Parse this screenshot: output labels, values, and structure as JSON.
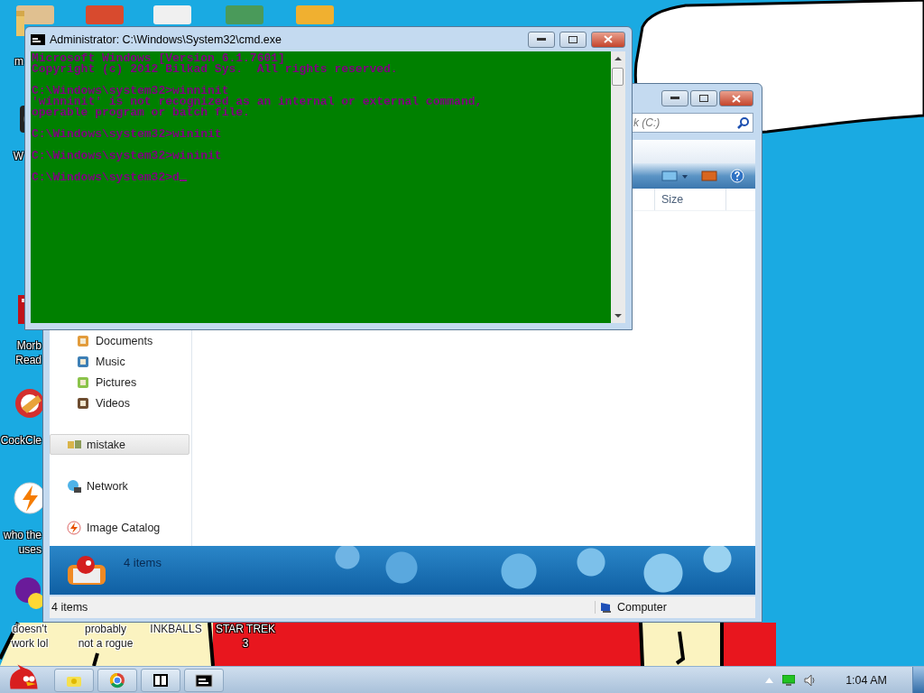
{
  "desktop_icons": [
    {
      "label": "m",
      "kind": "folder"
    },
    {
      "label": "W",
      "kind": "app"
    },
    {
      "label": "Morb\nRead",
      "kind": "book"
    },
    {
      "label": "CockCle",
      "kind": "cleaner"
    },
    {
      "label": "who the\nuses",
      "kind": "flash"
    },
    {
      "label": "doesn't\nwork lol",
      "kind": "yahoo"
    },
    {
      "label": "probably\nnot a rogue",
      "kind": "hidden"
    },
    {
      "label": "INKBALLS",
      "kind": "hidden"
    },
    {
      "label": "STAR TREK\n3",
      "kind": "hidden"
    }
  ],
  "explorer": {
    "search": {
      "placeholder": "k (C:)"
    },
    "columns": [
      "Size"
    ],
    "nav": [
      {
        "label": "Documents",
        "kind": "library",
        "selected": false
      },
      {
        "label": "Music",
        "kind": "library",
        "selected": false
      },
      {
        "label": "Pictures",
        "kind": "library",
        "selected": false
      },
      {
        "label": "Videos",
        "kind": "library",
        "selected": false
      },
      {
        "label": "mistake",
        "kind": "homegroup",
        "selected": true
      },
      {
        "label": "Network",
        "kind": "network",
        "selected": false
      },
      {
        "label": "Image Catalog",
        "kind": "catalog",
        "selected": false
      }
    ],
    "details": {
      "count": "4 items"
    },
    "status_bar": {
      "count": "4 items",
      "location": "Computer"
    }
  },
  "cmd": {
    "title": "Administrator: C:\\Windows\\System32\\cmd.exe",
    "blocks": [
      [
        "Microsoft Windows [Version 6.1.7601]",
        "Copyright (c) 2012 Bilkad Sys.  All rights reserved."
      ],
      [
        "C:\\Windows\\system32>winninit",
        "'winninit' is not recognized as an internal or external command,",
        "operable program or batch file."
      ],
      [
        "C:\\Windows\\system32>wininit"
      ],
      [
        "C:\\Windows\\system32>wininit"
      ],
      [
        "C:\\Windows\\system32>d"
      ]
    ]
  },
  "taskbar": {
    "buttons": [
      {
        "kind": "folder"
      },
      {
        "kind": "browser"
      },
      {
        "kind": "archive"
      },
      {
        "kind": "console"
      }
    ],
    "clock": "1:04 AM"
  }
}
